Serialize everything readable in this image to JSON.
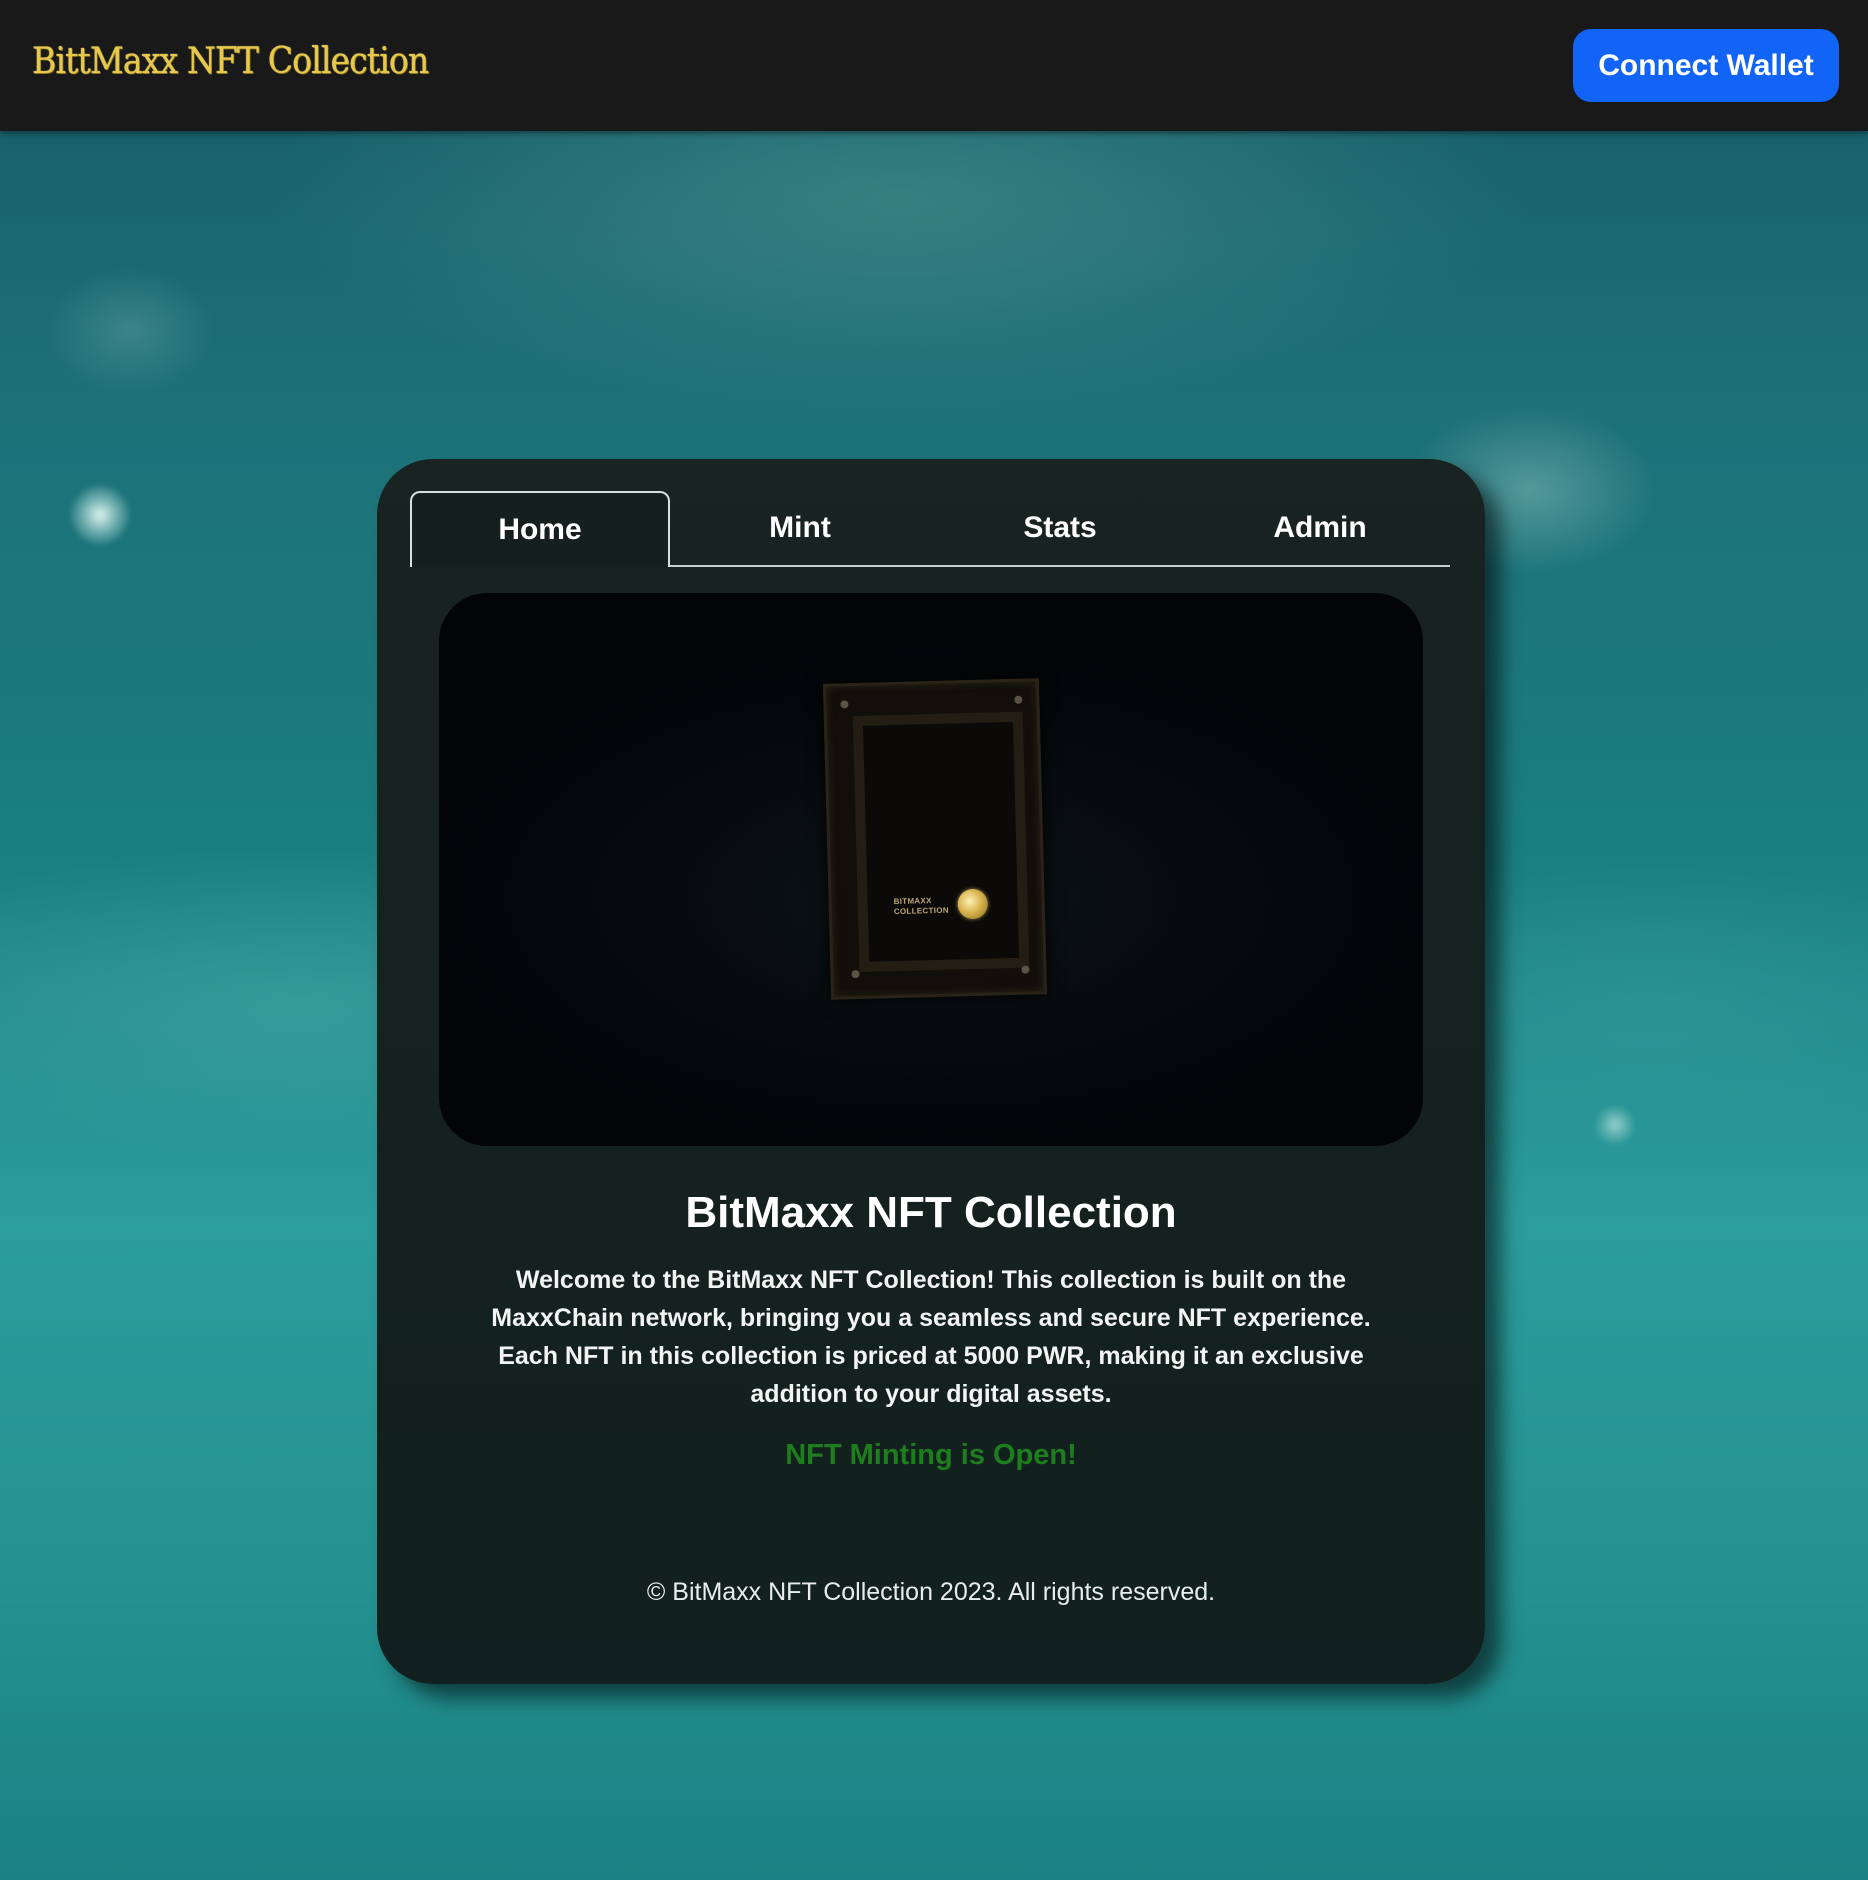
{
  "header": {
    "logo_text": "BittMaxx NFT Collection",
    "connect_wallet_label": "Connect Wallet"
  },
  "tabs": [
    {
      "label": "Home",
      "active": true
    },
    {
      "label": "Mint",
      "active": false
    },
    {
      "label": "Stats",
      "active": false
    },
    {
      "label": "Admin",
      "active": false
    }
  ],
  "hero": {
    "image_description_icon": "nft-case-image",
    "case_label_line1": "BITMAXX",
    "case_label_line2": "COLLECTION"
  },
  "content": {
    "title": "BitMaxx NFT Collection",
    "description": "Welcome to the BitMaxx NFT Collection! This collection is built on the MaxxChain network, bringing you a seamless and secure NFT experience. Each NFT in this collection is priced at 5000 PWR, making it an exclusive addition to your digital assets.",
    "minting_status": "NFT Minting is Open!"
  },
  "footer": {
    "copyright": "© BitMaxx NFT Collection 2023. All rights reserved."
  },
  "colors": {
    "header_bg": "#191919",
    "logo_gold": "#e7c84a",
    "button_blue": "#1164f5",
    "card_bg": "#192321",
    "status_green": "#1e7e1e"
  }
}
